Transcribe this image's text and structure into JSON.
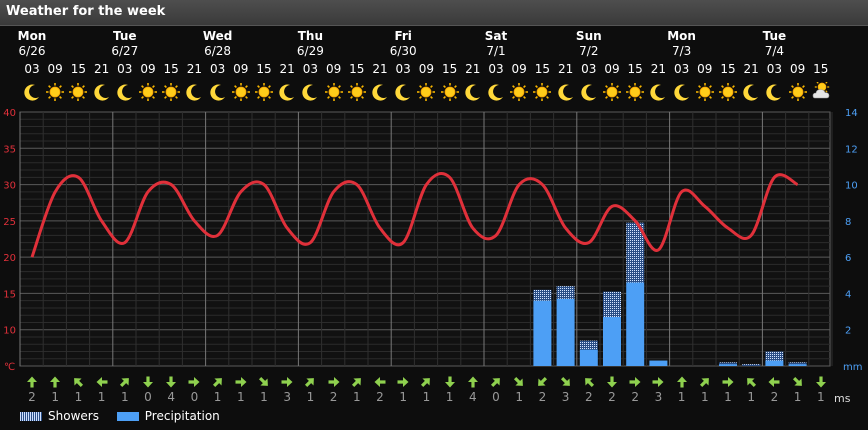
{
  "title": "Weather for the week",
  "days": [
    {
      "name": "Mon",
      "date": "6/26"
    },
    {
      "name": "Tue",
      "date": "6/27"
    },
    {
      "name": "Wed",
      "date": "6/28"
    },
    {
      "name": "Thu",
      "date": "6/29"
    },
    {
      "name": "Fri",
      "date": "6/30"
    },
    {
      "name": "Sat",
      "date": "7/1"
    },
    {
      "name": "Sun",
      "date": "7/2"
    },
    {
      "name": "Mon",
      "date": "7/3"
    },
    {
      "name": "Tue",
      "date": "7/4"
    }
  ],
  "hours": [
    "03",
    "09",
    "15",
    "21",
    "03",
    "09",
    "15",
    "21",
    "03",
    "09",
    "15",
    "21",
    "03",
    "09",
    "15",
    "21",
    "03",
    "09",
    "15",
    "21",
    "03",
    "09",
    "15",
    "21",
    "03",
    "09",
    "15",
    "21",
    "03",
    "09",
    "15",
    "21",
    "03",
    "09",
    "15"
  ],
  "icons": [
    "moon",
    "sun",
    "sun",
    "moon",
    "moon",
    "sun",
    "sun",
    "moon",
    "moon",
    "sun",
    "sun",
    "moon",
    "moon",
    "sun",
    "sun",
    "moon",
    "moon",
    "sun",
    "sun",
    "moon",
    "moon",
    "sun",
    "sun",
    "moon",
    "moon",
    "sun",
    "sun",
    "moon",
    "moon",
    "sun",
    "sun",
    "moon",
    "moon",
    "sun",
    "partly-cloudy-day",
    "moon",
    "moon",
    "sun",
    "sun",
    "moon",
    "moon",
    "sun",
    "rain-cloud",
    "rain-cloud",
    "rain-cloud",
    "rain-cloud",
    "rain-cloud",
    "moon",
    "moon",
    "partly-cloudy-day",
    "cloudy",
    "partly-cloudy-night",
    "partly-cloudy-night",
    "partly-cloudy-day",
    "partly-cloudy-day"
  ],
  "units": {
    "temp": "℃",
    "precip": "mm",
    "wind": "ms"
  },
  "legend": {
    "showers": "Showers",
    "precipitation": "Precipitation"
  },
  "colors": {
    "temperature": "#e0303a",
    "precipitation": "#4d9ff5",
    "showers": "#a9c8f0",
    "wind": "#8fd14f",
    "left_axis": "#e0303a",
    "right_axis": "#4d9ff5"
  },
  "wind": {
    "directions": [
      "N",
      "N",
      "NW",
      "W",
      "NE",
      "S",
      "S",
      "E",
      "NE",
      "E",
      "SE",
      "E",
      "NE",
      "E",
      "NE",
      "W",
      "E",
      "NE",
      "S",
      "N",
      "NE",
      "SE",
      "SW",
      "SE",
      "NW",
      "S",
      "E",
      "E",
      "N",
      "NE",
      "E",
      "NW",
      "W",
      "SE",
      "S"
    ],
    "speeds": [
      "2",
      "1",
      "1",
      "1",
      "1",
      "0",
      "4",
      "0",
      "1",
      "1",
      "1",
      "3",
      "1",
      "2",
      "1",
      "2",
      "1",
      "1",
      "1",
      "4",
      "0",
      "1",
      "2",
      "3",
      "2",
      "2",
      "2",
      "3",
      "1",
      "1",
      "1",
      "1",
      "2",
      "1",
      "1",
      "1",
      "2"
    ]
  },
  "chart_data": {
    "type": "line",
    "x_hours": [
      "03",
      "09",
      "15",
      "21",
      "03",
      "09",
      "15",
      "21",
      "03",
      "09",
      "15",
      "21",
      "03",
      "09",
      "15",
      "21",
      "03",
      "09",
      "15",
      "21",
      "03",
      "09",
      "15",
      "21",
      "03",
      "09",
      "15",
      "21",
      "03",
      "09",
      "15",
      "21",
      "03",
      "09",
      "15"
    ],
    "temperature": [
      20,
      29,
      31,
      25,
      22,
      29,
      30,
      25,
      23,
      29,
      30,
      24,
      22,
      29,
      30,
      24,
      22,
      30,
      31,
      24,
      23,
      30,
      30,
      24,
      22,
      27,
      25,
      21,
      29,
      27,
      24,
      23,
      31,
      30
    ],
    "left_axis": {
      "ticks": [
        40,
        35,
        30,
        25,
        20,
        15,
        10
      ],
      "unit": "℃",
      "range": [
        5,
        40
      ]
    },
    "right_axis": {
      "ticks": [
        14,
        12,
        10,
        8,
        6,
        4,
        2
      ],
      "unit": "mm",
      "range": [
        0,
        14
      ]
    },
    "precipitation_mm": [
      {
        "index": 22,
        "showers": 0.6,
        "rain": 3.6
      },
      {
        "index": 23,
        "showers": 0.7,
        "rain": 3.7
      },
      {
        "index": 24,
        "showers": 0.5,
        "rain": 0.9
      },
      {
        "index": 25,
        "showers": 1.4,
        "rain": 2.7
      },
      {
        "index": 26,
        "showers": 3.3,
        "rain": 4.6
      },
      {
        "index": 27,
        "showers": 0.0,
        "rain": 0.3
      },
      {
        "index": 30,
        "showers": 0.1,
        "rain": 0.1
      },
      {
        "index": 31,
        "showers": 0.1,
        "rain": 0.0
      },
      {
        "index": 32,
        "showers": 0.5,
        "rain": 0.3
      },
      {
        "index": 33,
        "showers": 0.1,
        "rain": 0.1
      }
    ]
  }
}
